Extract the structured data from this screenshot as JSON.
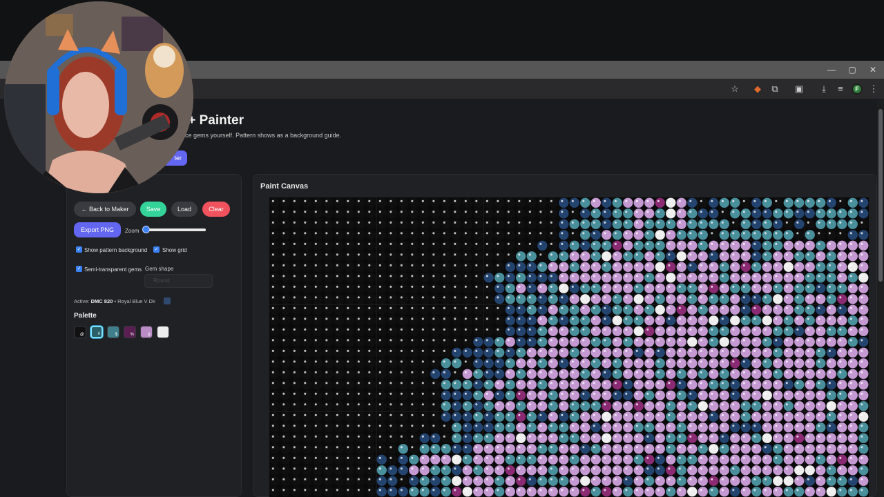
{
  "browser": {
    "window_controls": [
      "—",
      "▢",
      "✕"
    ],
    "toolbar_icons": [
      "star-icon",
      "extension-fox-icon",
      "puzzle-icon",
      "sidebar-icon",
      "download-icon",
      "menu-list-icon",
      "profile-icon",
      "kebab-menu-icon"
    ],
    "profile_initial": "F"
  },
  "header": {
    "title": "Maker + Painter",
    "subtitle": "colors and place gems yourself. Pattern shows as a background guide.",
    "button_label": "ter"
  },
  "tools": {
    "title": "ols",
    "buttons": {
      "back": "← Back to Maker",
      "save": "Save",
      "load": "Load",
      "clear": "Clear",
      "export": "Export PNG"
    },
    "zoom_label": "Zoom",
    "zoom_value": 0.0,
    "checkboxes": {
      "pattern_bg": "Show pattern background",
      "grid": "Show grid",
      "semi": "Semi-transparent gems"
    },
    "gem_shape_label": "Gem shape",
    "gem_shape_value": "Round",
    "active_prefix": "Active:",
    "active_code": "DMC 820",
    "active_name": "• Royal Blue V Dk",
    "active_color": "#2f4a6e"
  },
  "palette": {
    "title": "Palette",
    "items": [
      {
        "color": "#111111",
        "symbol": "@"
      },
      {
        "color": "#2a5f6a",
        "symbol": "#"
      },
      {
        "color": "#3f7f8c",
        "symbol": "$"
      },
      {
        "color": "#5a1e52",
        "symbol": "%"
      },
      {
        "color": "#b98cc6",
        "symbol": "&"
      },
      {
        "color": "#eeeeee",
        "symbol": "*"
      }
    ],
    "selected_index": 1
  },
  "canvas": {
    "title": "Paint Canvas",
    "colors": {
      "black": "#0f0f10",
      "navy": "#244470",
      "teal": "#4a8f9c",
      "plum": "#8a2a72",
      "lilac": "#c59ad3",
      "white": "#eeeeee"
    }
  }
}
